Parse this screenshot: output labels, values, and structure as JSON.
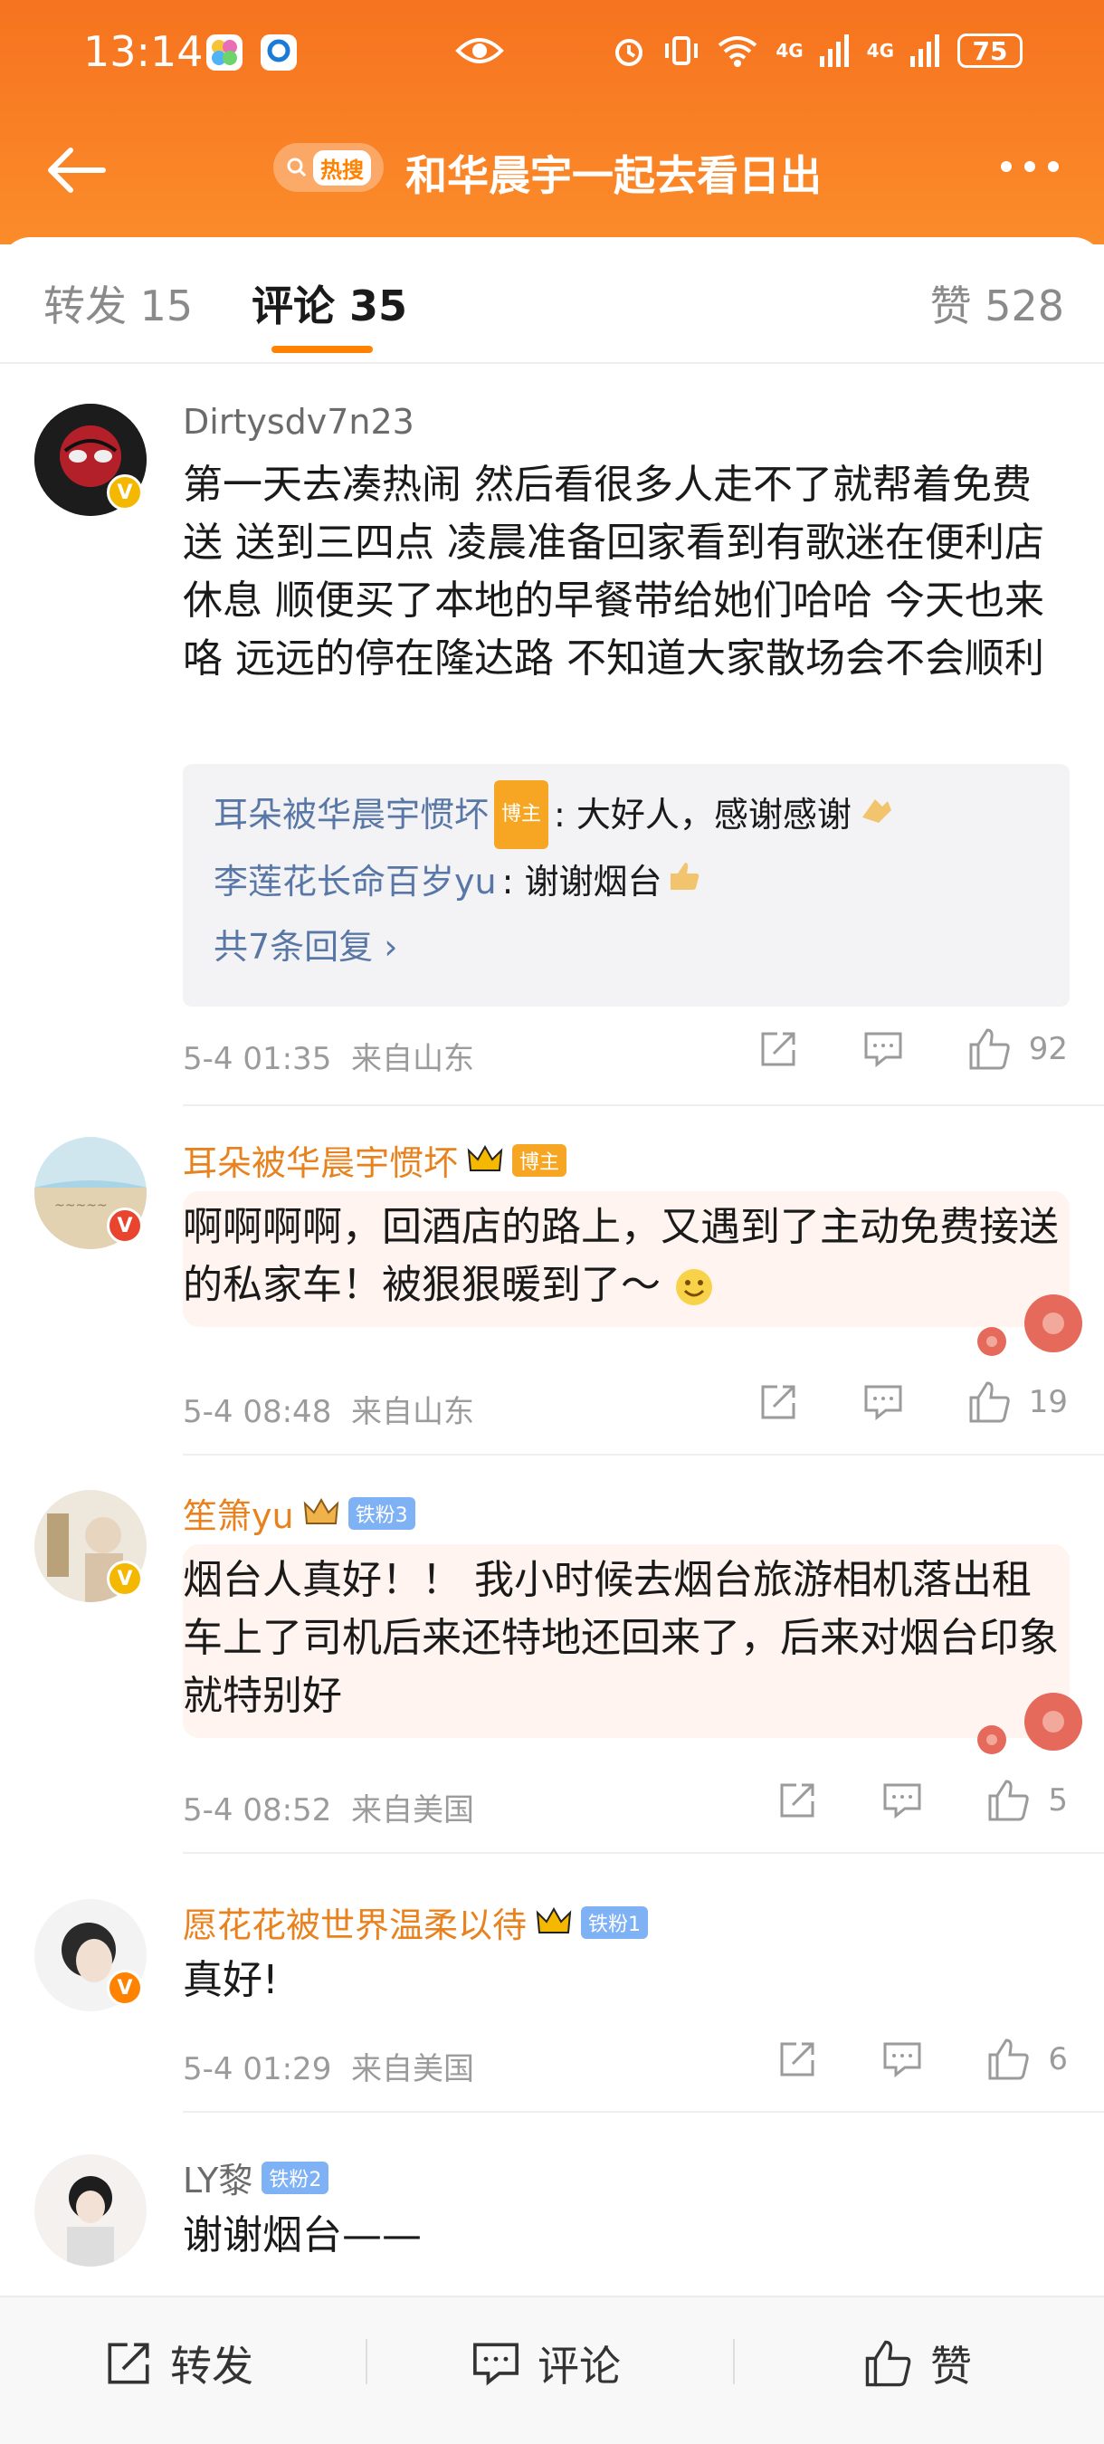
{
  "status_bar": {
    "time": "13:14",
    "network": "4G",
    "battery": "75"
  },
  "nav": {
    "hot_label": "热搜",
    "title": "和华晨宇一起去看日出"
  },
  "tabs": {
    "repost": "转发 15",
    "comment": "评论 35",
    "like": "赞 528"
  },
  "comments": [
    {
      "username": "Dirtysdv7n23",
      "text": "第一天去凑热闹 然后看很多人走不了就帮着免费送 送到三四点 凌晨准备回家看到有歌迷在便利店休息 顺便买了本地的早餐带给她们哈哈 今天也来咯 远远的停在隆达路 不知道大家散场会不会顺利",
      "replies": [
        {
          "name": "耳朵被华晨宇惯坏",
          "tag": "博主",
          "text": ": 大好人，感谢感谢"
        },
        {
          "name": "李莲花长命百岁yu",
          "text": ": 谢谢烟台"
        }
      ],
      "more_replies": "共7条回复",
      "time": "5-4 01:35",
      "location": "来自山东",
      "likes": "92"
    },
    {
      "username": "耳朵被华晨宇惯坏",
      "tag": "博主",
      "text": "啊啊啊啊，回酒店的路上，又遇到了主动免费接送的私家车！被狠狠暖到了～",
      "time": "5-4 08:48",
      "location": "来自山东",
      "likes": "19"
    },
    {
      "username": "笙箫yu",
      "tag": "铁粉3",
      "text": "烟台人真好！！ 我小时候去烟台旅游相机落出租车上了司机后来还特地还回来了，后来对烟台印象就特别好",
      "time": "5-4 08:52",
      "location": "来自美国",
      "likes": "5"
    },
    {
      "username": "愿花花被世界温柔以待",
      "tag": "铁粉1",
      "text": "真好!",
      "time": "5-4 01:29",
      "location": "来自美国",
      "likes": "6"
    },
    {
      "username": "LY黎",
      "tag": "铁粉2",
      "text": "谢谢烟台——"
    }
  ],
  "bottom_bar": {
    "repost": "转发",
    "comment": "评论",
    "like": "赞"
  },
  "colors": {
    "header_orange": "#f6731f",
    "accent": "#ff8200",
    "reply_name": "#5877a6"
  }
}
